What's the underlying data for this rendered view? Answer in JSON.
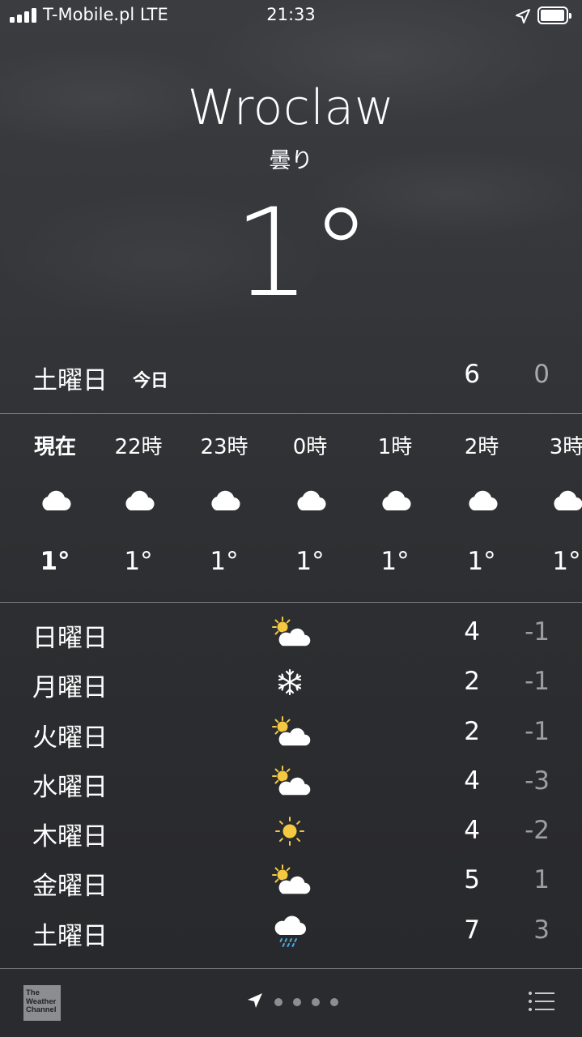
{
  "status_bar": {
    "carrier": "T-Mobile.pl LTE",
    "time": "21:33"
  },
  "location": {
    "city": "Wroclaw",
    "condition": "曇り",
    "temperature": "1°"
  },
  "today": {
    "day": "土曜日",
    "label": "今日",
    "high": "6",
    "low": "0"
  },
  "hourly": [
    {
      "time": "現在",
      "icon": "cloud-icon",
      "temp": "1°",
      "current": true
    },
    {
      "time": "22時",
      "icon": "cloud-icon",
      "temp": "1°"
    },
    {
      "time": "23時",
      "icon": "cloud-icon",
      "temp": "1°"
    },
    {
      "time": "0時",
      "icon": "cloud-icon",
      "temp": "1°"
    },
    {
      "time": "1時",
      "icon": "cloud-icon",
      "temp": "1°"
    },
    {
      "time": "2時",
      "icon": "cloud-icon",
      "temp": "1°"
    },
    {
      "time": "3時",
      "icon": "cloud-icon",
      "temp": "1°"
    }
  ],
  "daily": [
    {
      "day": "日曜日",
      "icon": "partly-cloudy-icon",
      "high": "4",
      "low": "-1"
    },
    {
      "day": "月曜日",
      "icon": "snowflake-icon",
      "high": "2",
      "low": "-1"
    },
    {
      "day": "火曜日",
      "icon": "partly-cloudy-icon",
      "high": "2",
      "low": "-1"
    },
    {
      "day": "水曜日",
      "icon": "partly-cloudy-icon",
      "high": "4",
      "low": "-3"
    },
    {
      "day": "木曜日",
      "icon": "sun-icon",
      "high": "4",
      "low": "-2"
    },
    {
      "day": "金曜日",
      "icon": "partly-cloudy-icon",
      "high": "5",
      "low": "1"
    },
    {
      "day": "土曜日",
      "icon": "rain-cloud-icon",
      "high": "7",
      "low": "3"
    }
  ],
  "bottom_bar": {
    "logo_lines": [
      "The",
      "Weather",
      "Channel"
    ],
    "page_count": 4
  },
  "colors": {
    "sun": "#f5c842",
    "rain": "#4aa8e6",
    "secondary_text": "#a8a9ab"
  }
}
